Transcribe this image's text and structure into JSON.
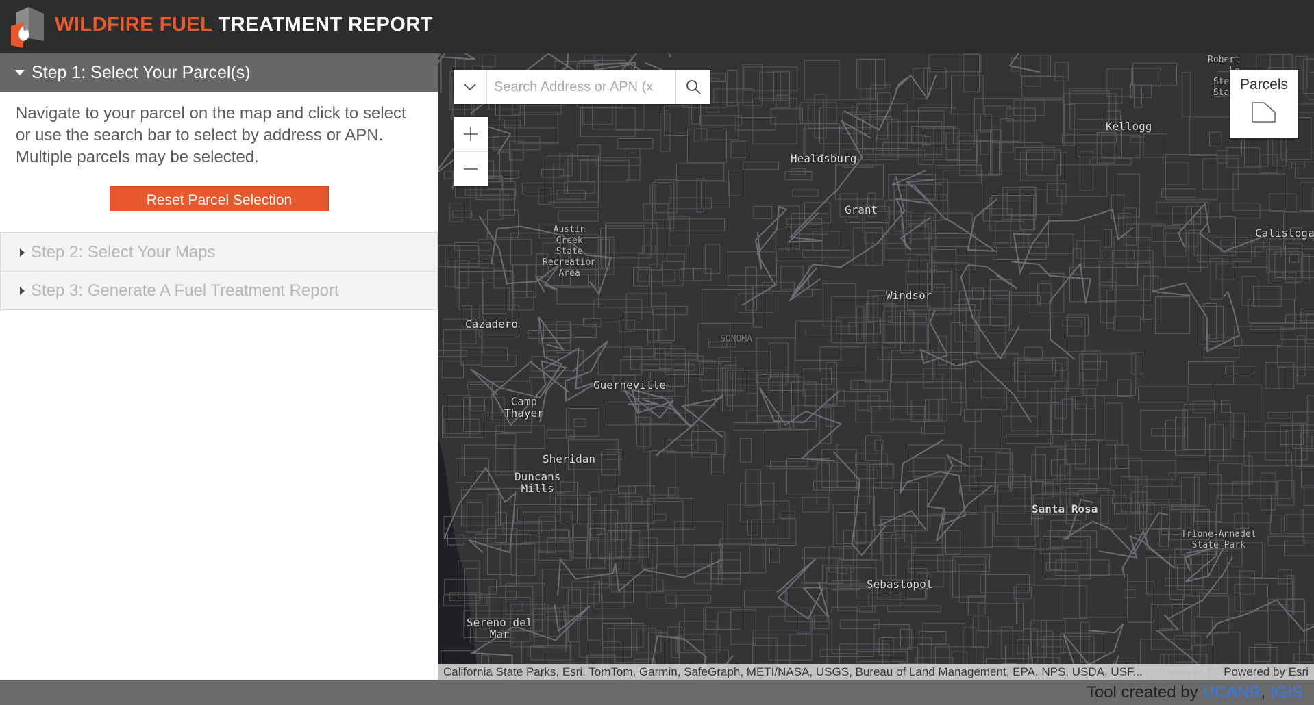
{
  "header": {
    "title_accent": "WILDFIRE FUEL",
    "title_main": "TREATMENT REPORT"
  },
  "sidebar": {
    "step1": {
      "label": "Step 1: Select Your Parcel(s)",
      "instructions": "Navigate to your parcel on the map and click to select or use the search bar to select by address or APN. Multiple parcels may be selected.",
      "reset_label": "Reset Parcel Selection"
    },
    "step2": {
      "label": "Step 2: Select Your Maps"
    },
    "step3": {
      "label": "Step 3: Generate A Fuel Treatment Report"
    }
  },
  "map": {
    "search_placeholder": "Search Address or APN (x",
    "legend_title": "Parcels",
    "places": [
      {
        "name": "Healdsburg"
      },
      {
        "name": "Grant"
      },
      {
        "name": "Kellogg"
      },
      {
        "name": "Calistoga"
      },
      {
        "name": "Windsor"
      },
      {
        "name": "Cazadero"
      },
      {
        "name": "Guerneville"
      },
      {
        "name": "Camp\nThayer"
      },
      {
        "name": "Sheridan"
      },
      {
        "name": "Duncans\nMills"
      },
      {
        "name": "Santa Rosa"
      },
      {
        "name": "Sebastopol"
      },
      {
        "name": "Sereno del\nMar"
      },
      {
        "name": "Austin\nCreek\nState\nRecreation\nArea"
      },
      {
        "name": "SONOMA"
      },
      {
        "name": "Trione-Annadel\nState Park"
      },
      {
        "name": "Robert\nLo\nSteve\nState"
      }
    ],
    "attribution": "California State Parks, Esri, TomTom, Garmin, SafeGraph, METI/NASA, USGS, Bureau of Land Management, EPA, NPS, USDA, USF...",
    "powered_by": "Powered by Esri"
  },
  "footer": {
    "prefix": "Tool created by",
    "link1": "UCANR",
    "separator": ",",
    "link2": "IGIS"
  },
  "colors": {
    "accent": "#e8582f",
    "header_bg": "#2d2d2d",
    "map_bg": "#333436",
    "link": "#2f7cf4"
  }
}
